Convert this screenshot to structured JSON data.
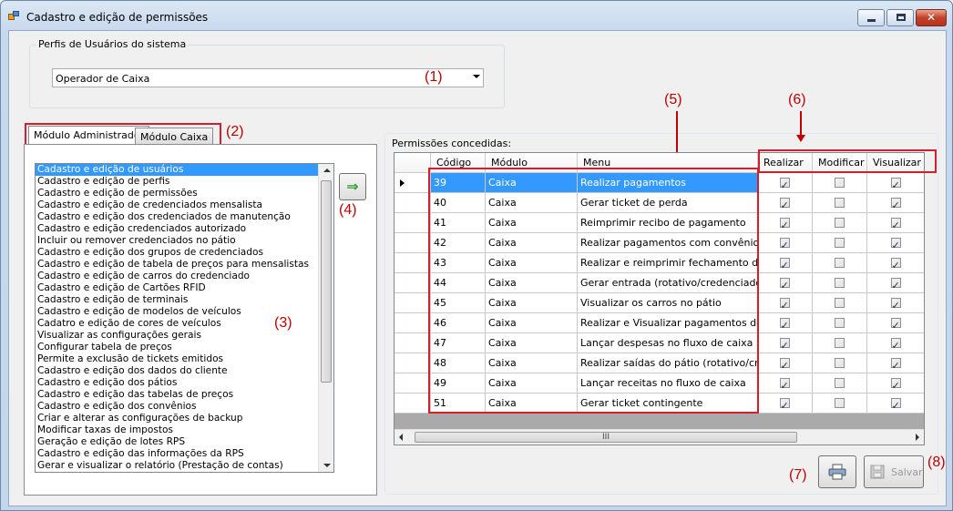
{
  "window": {
    "title": "Cadastro e edição de permissões"
  },
  "profiles_group": {
    "label": "Perfis de Usuários do sistema",
    "selected": "Operador de Caixa"
  },
  "tabs": [
    {
      "label": "Módulo Administrador",
      "active": true
    },
    {
      "label": "Módulo Caixa",
      "active": false
    }
  ],
  "menu_list": {
    "selected_index": 0,
    "items": [
      "Cadastro e edição de usuários",
      "Cadastro e edição de perfis",
      "Cadastro e edição de permissões",
      "Cadastro e edição de credenciados mensalista",
      "Cadastro e edição dos credenciados de manutenção",
      "Cadastro e edição credenciados autorizado",
      "Incluir ou remover credenciados no pátio",
      "Cadastro e edição dos grupos de credenciados",
      "Cadastro e edição de tabela de preços para mensalistas",
      "Cadastro e edição de carros do credenciado",
      "Cadastro e edição de Cartões RFID",
      "Cadastro e edição de terminais",
      "Cadastro e edição de modelos de veículos",
      "Cadatro e edição de cores de veículos",
      "Visualizar as configurações gerais",
      "Configurar tabela de preços",
      "Permite a exclusão de tickets emitidos",
      "Cadastro e edição dos dados do cliente",
      "Cadastro e edição dos pátios",
      "Cadastro e edição das tabelas de preços",
      "Cadastro e edição dos convênios",
      "Criar e alterar as configurações de backup",
      "Modificar taxas de impostos",
      "Geração e edição de lotes RPS",
      "Cadastro e edição das informações da RPS",
      "Gerar e visualizar o relatório (Prestação de contas)"
    ]
  },
  "add_button": {
    "icon": "arrow-right-icon",
    "glyph": "⇒"
  },
  "permissions": {
    "label": "Permissões concedidas:",
    "columns": [
      "Código",
      "Módulo",
      "Menu",
      "Realizar",
      "Modificar",
      "Visualizar"
    ],
    "rows": [
      {
        "code": "39",
        "module": "Caixa",
        "menu": "Realizar pagamentos",
        "realizar": true,
        "modificar": false,
        "visualizar": true
      },
      {
        "code": "40",
        "module": "Caixa",
        "menu": "Gerar ticket de perda",
        "realizar": true,
        "modificar": false,
        "visualizar": true
      },
      {
        "code": "41",
        "module": "Caixa",
        "menu": "Reimprimir recibo de pagamento",
        "realizar": true,
        "modificar": false,
        "visualizar": true
      },
      {
        "code": "42",
        "module": "Caixa",
        "menu": "Realizar pagamentos com convênio",
        "realizar": true,
        "modificar": false,
        "visualizar": true
      },
      {
        "code": "43",
        "module": "Caixa",
        "menu": "Realizar  e reimprimir fechamento de c...",
        "realizar": true,
        "modificar": false,
        "visualizar": true
      },
      {
        "code": "44",
        "module": "Caixa",
        "menu": "Gerar entrada (rotativo/credenciado)",
        "realizar": true,
        "modificar": false,
        "visualizar": true
      },
      {
        "code": "45",
        "module": "Caixa",
        "menu": "Visualizar os carros no pátio",
        "realizar": true,
        "modificar": false,
        "visualizar": true
      },
      {
        "code": "46",
        "module": "Caixa",
        "menu": "Realizar e Visualizar pagamentos de m...",
        "realizar": true,
        "modificar": false,
        "visualizar": true
      },
      {
        "code": "47",
        "module": "Caixa",
        "menu": "Lançar despesas no fluxo de caixa",
        "realizar": true,
        "modificar": false,
        "visualizar": true
      },
      {
        "code": "48",
        "module": "Caixa",
        "menu": "Realizar saídas do pátio (rotativo/cred...",
        "realizar": true,
        "modificar": false,
        "visualizar": true
      },
      {
        "code": "49",
        "module": "Caixa",
        "menu": "Lançar receitas no fluxo de caixa",
        "realizar": true,
        "modificar": false,
        "visualizar": true
      },
      {
        "code": "51",
        "module": "Caixa",
        "menu": "Gerar ticket contingente",
        "realizar": true,
        "modificar": false,
        "visualizar": true
      }
    ],
    "scroll_grip": "III"
  },
  "buttons": {
    "print_icon": "printer-icon",
    "save_label": "Salvar",
    "save_icon": "floppy-disk-icon"
  },
  "annotations": [
    "(1)",
    "(2)",
    "(3)",
    "(4)",
    "(5)",
    "(6)",
    "(7)",
    "(8)"
  ],
  "annotation_color": "#c00000"
}
